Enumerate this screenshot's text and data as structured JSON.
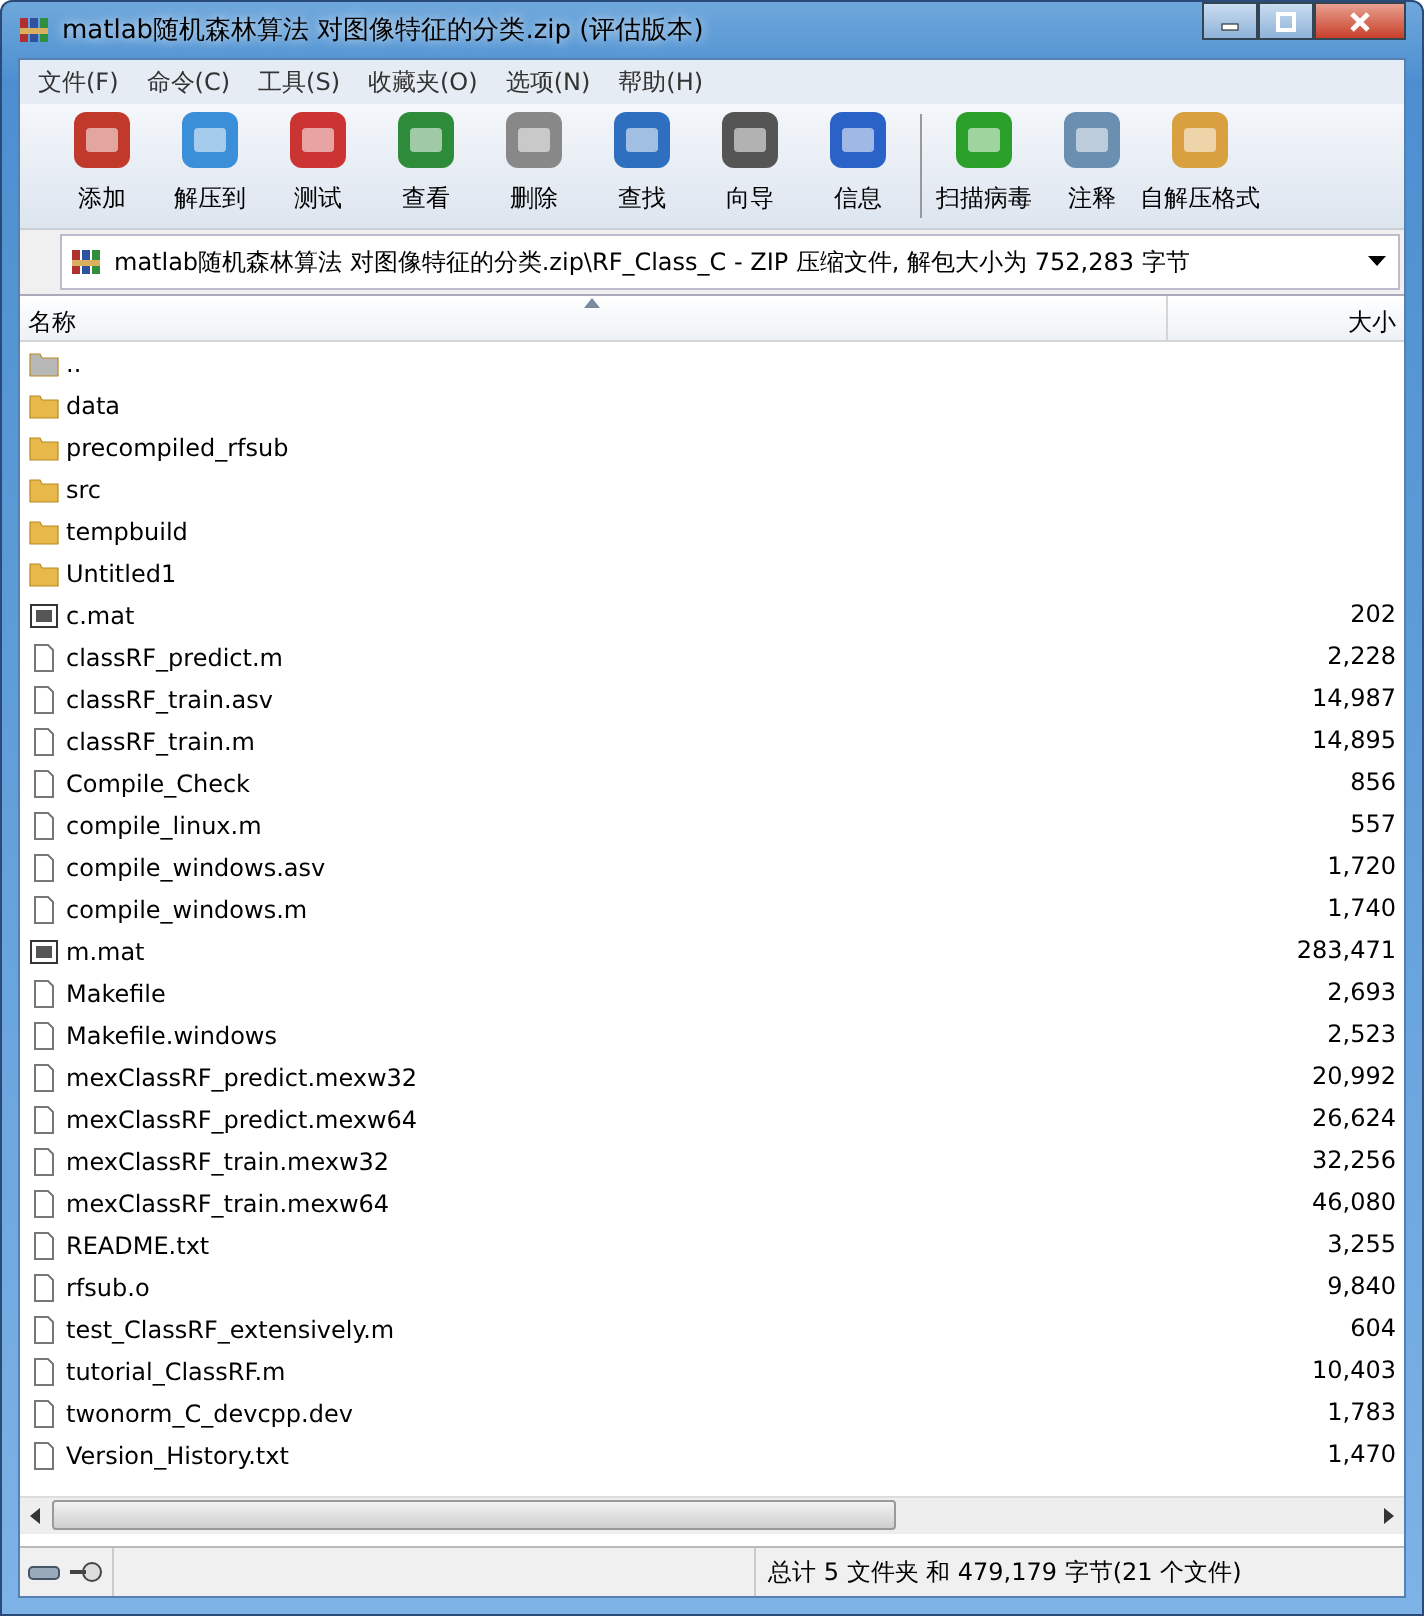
{
  "window": {
    "title": "matlab随机森林算法 对图像特征的分类.zip (评估版本)"
  },
  "menu": [
    "文件(F)",
    "命令(C)",
    "工具(S)",
    "收藏夹(O)",
    "选项(N)",
    "帮助(H)"
  ],
  "toolbar": {
    "groups": [
      [
        "添加",
        "解压到",
        "测试",
        "查看",
        "删除",
        "查找",
        "向导",
        "信息"
      ],
      [
        "扫描病毒",
        "注释",
        "自解压格式"
      ]
    ]
  },
  "address": {
    "path": "matlab随机森林算法 对图像特征的分类.zip\\RF_Class_C - ZIP 压缩文件, 解包大小为 752,283 字节"
  },
  "table": {
    "columns": [
      "名称",
      "大小"
    ],
    "rows": [
      {
        "kind": "parent",
        "name": ".."
      },
      {
        "kind": "folder",
        "name": "data"
      },
      {
        "kind": "folder",
        "name": "precompiled_rfsub"
      },
      {
        "kind": "folder",
        "name": "src"
      },
      {
        "kind": "folder",
        "name": "tempbuild"
      },
      {
        "kind": "folder",
        "name": "Untitled1"
      },
      {
        "kind": "data",
        "name": "c.mat",
        "size": "202"
      },
      {
        "kind": "file",
        "name": "classRF_predict.m",
        "size": "2,228"
      },
      {
        "kind": "file",
        "name": "classRF_train.asv",
        "size": "14,987"
      },
      {
        "kind": "file",
        "name": "classRF_train.m",
        "size": "14,895"
      },
      {
        "kind": "file",
        "name": "Compile_Check",
        "size": "856"
      },
      {
        "kind": "file",
        "name": "compile_linux.m",
        "size": "557"
      },
      {
        "kind": "file",
        "name": "compile_windows.asv",
        "size": "1,720"
      },
      {
        "kind": "file",
        "name": "compile_windows.m",
        "size": "1,740"
      },
      {
        "kind": "data",
        "name": "m.mat",
        "size": "283,471"
      },
      {
        "kind": "file",
        "name": "Makefile",
        "size": "2,693"
      },
      {
        "kind": "file",
        "name": "Makefile.windows",
        "size": "2,523"
      },
      {
        "kind": "file",
        "name": "mexClassRF_predict.mexw32",
        "size": "20,992"
      },
      {
        "kind": "file",
        "name": "mexClassRF_predict.mexw64",
        "size": "26,624"
      },
      {
        "kind": "file",
        "name": "mexClassRF_train.mexw32",
        "size": "32,256"
      },
      {
        "kind": "file",
        "name": "mexClassRF_train.mexw64",
        "size": "46,080"
      },
      {
        "kind": "file",
        "name": "README.txt",
        "size": "3,255"
      },
      {
        "kind": "file",
        "name": "rfsub.o",
        "size": "9,840"
      },
      {
        "kind": "file",
        "name": "test_ClassRF_extensively.m",
        "size": "604"
      },
      {
        "kind": "file",
        "name": "tutorial_ClassRF.m",
        "size": "10,403"
      },
      {
        "kind": "file",
        "name": "twonorm_C_devcpp.dev",
        "size": "1,783"
      },
      {
        "kind": "file",
        "name": "Version_History.txt",
        "size": "1,470"
      }
    ]
  },
  "status_bar": {
    "text": "总计 5 文件夹 和 479,179 字节(21 个文件)"
  }
}
